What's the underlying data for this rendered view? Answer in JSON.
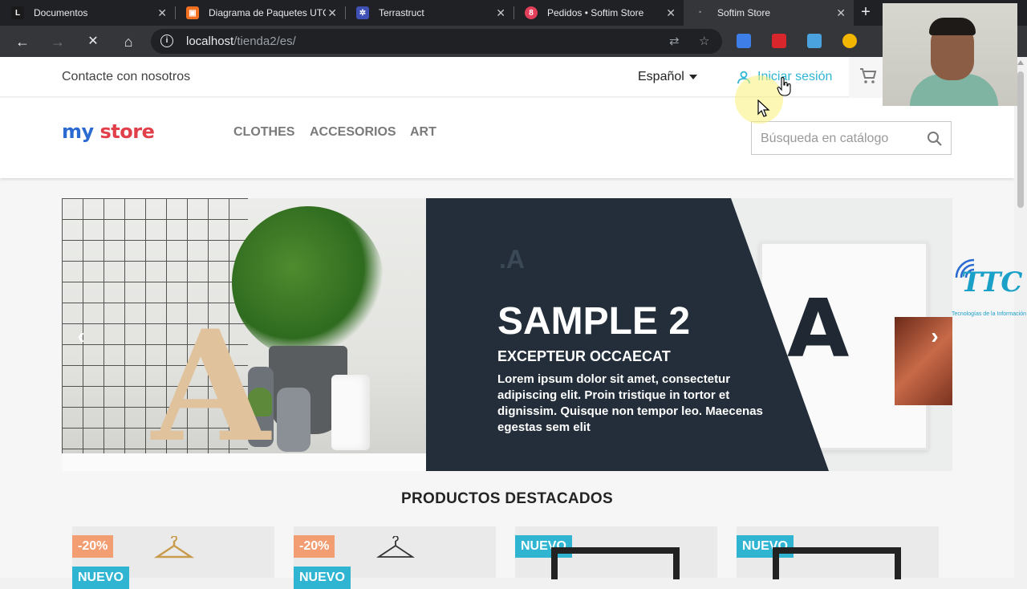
{
  "browser": {
    "tabs": [
      {
        "title": "Documentos",
        "favicon": "L",
        "favicon_color": "#1a1a1a"
      },
      {
        "title": "Diagrama de Paquetes UTC",
        "favicon": "▣",
        "favicon_color": "#f37021"
      },
      {
        "title": "Terrastruct",
        "favicon": "✲",
        "favicon_color": "#3f51b5"
      },
      {
        "title": "Pedidos • Softim Store",
        "favicon": "8",
        "favicon_color": "#e43f5a"
      },
      {
        "title": "Softim Store",
        "favicon": "",
        "favicon_color": "#35363a"
      }
    ],
    "url_host": "localhost",
    "url_path": "/tienda2/es/"
  },
  "store": {
    "contact": "Contacte con nosotros",
    "language": "Español",
    "signin": "Iniciar sesión",
    "logo_my": "my",
    "logo_store": "store",
    "menu": [
      "CLOTHES",
      "ACCESORIOS",
      "ART"
    ],
    "search_placeholder": "Búsqueda en catálogo",
    "slide": {
      "title": "SAMPLE 2",
      "subtitle": "EXCEPTEUR OCCAECAT",
      "text": "Lorem ipsum dolor sit amet, consectetur adipiscing elit. Proin tristique in tortor et dignissim. Quisque non tempor leo. Maecenas egestas sem elit"
    },
    "featured_title": "PRODUCTOS DESTACADOS",
    "products": [
      {
        "badge": "-20%",
        "badge2": "NUEVO"
      },
      {
        "badge": "-20%",
        "badge2": "NUEVO"
      },
      {
        "badge": "NUEVO"
      },
      {
        "badge": "NUEVO"
      }
    ]
  },
  "overlay": {
    "ttc_caption": "Tecnologías de la Información"
  },
  "colors": {
    "accent": "#2fb5d2",
    "discount": "#f39d72",
    "slide_dark": "#232e3a"
  }
}
